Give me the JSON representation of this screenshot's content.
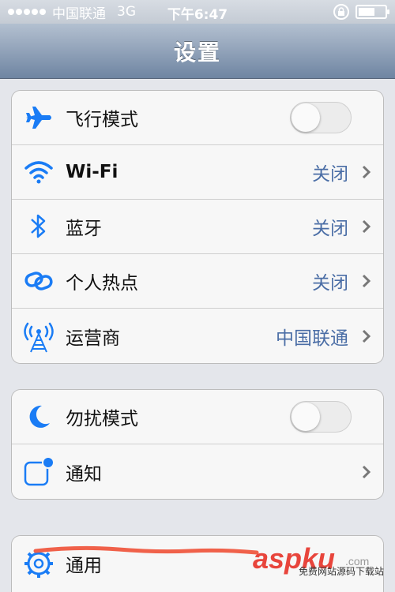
{
  "status_bar": {
    "carrier": "中国联通",
    "network": "3G",
    "time": "下午6:47",
    "battery_level": 0.62
  },
  "nav": {
    "title": "设置"
  },
  "groups": [
    {
      "rows": [
        {
          "label": "飞行模式",
          "icon": "airplane-icon",
          "toggle": false
        },
        {
          "label": "Wi-Fi",
          "value": "关闭",
          "icon": "wifi-icon"
        },
        {
          "label": "蓝牙",
          "value": "关闭",
          "icon": "bluetooth-icon"
        },
        {
          "label": "个人热点",
          "value": "关闭",
          "icon": "hotspot-icon"
        },
        {
          "label": "运营商",
          "value": "中国联通",
          "icon": "carrier-antenna-icon"
        }
      ]
    },
    {
      "rows": [
        {
          "label": "勿扰模式",
          "icon": "moon-icon",
          "toggle": false
        },
        {
          "label": "通知",
          "icon": "notification-icon"
        }
      ]
    },
    {
      "rows": [
        {
          "label": "通用",
          "icon": "gear-icon"
        }
      ]
    }
  ],
  "watermark": {
    "logo": "aspku",
    "logo_suffix": ".com",
    "tagline": "免费网站源码下载站"
  },
  "colors": {
    "accent_blue": "#1a7cf5",
    "value_blue": "#4b6ea6",
    "nav_gradient_top": "#b3c0d0",
    "nav_gradient_bottom": "#6f85a2"
  }
}
